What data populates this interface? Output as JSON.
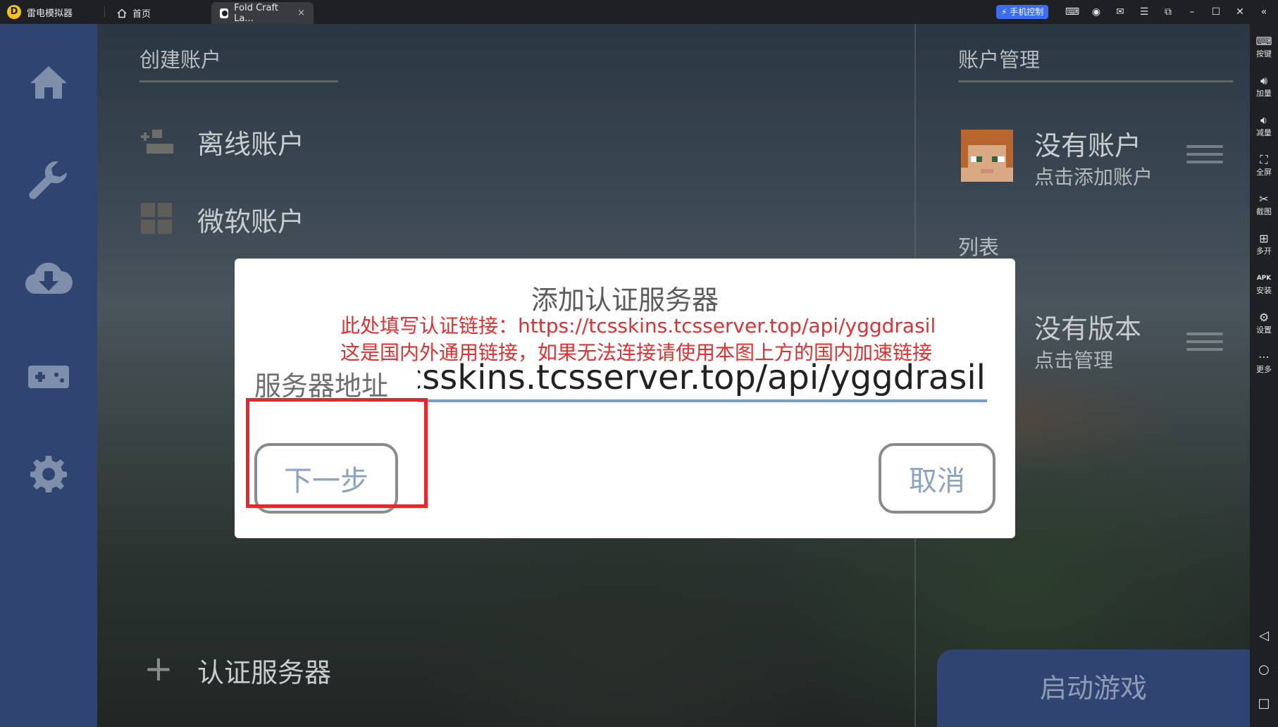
{
  "titlebar": {
    "app_name": "雷电模拟器",
    "tabs": [
      {
        "label": "首页"
      },
      {
        "label": "Fold Craft La..."
      }
    ],
    "close_glyph": "×",
    "phone_control": "手机控制",
    "icons": [
      "gamepad-icon",
      "user-icon",
      "mail-icon",
      "menu-icon",
      "restore-icon",
      "minimize-icon",
      "maximize-icon",
      "close-icon",
      "collapse-icon"
    ]
  },
  "rightbar": {
    "items": [
      {
        "label": "按键",
        "icon": "keyboard-icon"
      },
      {
        "label": "加量",
        "icon": "volume-up-icon"
      },
      {
        "label": "减量",
        "icon": "volume-down-icon"
      },
      {
        "label": "全屏",
        "icon": "fullscreen-icon"
      },
      {
        "label": "截图",
        "icon": "scissors-icon"
      },
      {
        "label": "多开",
        "icon": "multi-instance-icon"
      },
      {
        "label": "安装",
        "icon": "apk-icon"
      },
      {
        "label": "设置",
        "icon": "settings-icon"
      },
      {
        "label": "更多",
        "icon": "more-icon"
      }
    ],
    "nav": [
      "back-icon",
      "home-circle-icon",
      "recents-icon"
    ]
  },
  "left_panel": {
    "title": "创建账户",
    "items": [
      {
        "label": "离线账户",
        "icon": "offline-user-icon"
      },
      {
        "label": "微软账户",
        "icon": "microsoft-icon"
      }
    ],
    "auth_server": {
      "label": "认证服务器",
      "icon": "plus-icon",
      "glyph": "+"
    }
  },
  "right_panel": {
    "title": "账户管理",
    "account": {
      "title": "没有账户",
      "subtitle": "点击添加账户"
    },
    "list_title_partial": "列表",
    "version": {
      "title": "没有版本",
      "subtitle": "点击管理"
    }
  },
  "launch": {
    "label": "启动游戏"
  },
  "dialog": {
    "title": "添加认证服务器",
    "note_line1": "此处填写认证链接：https://tcsskins.tcsserver.top/api/yggdrasil",
    "note_line2": "这是国内外通用链接，如果无法连接请使用本图上方的国内加速链接",
    "field_label": "服务器地址",
    "field_value": "https://tcsskins.tcsserver.top/api/yggdrasil",
    "next_button": "下一步",
    "cancel_button": "取消"
  },
  "colors": {
    "sidebar": "#2f4470",
    "highlight_box": "#e8272b",
    "note_text": "#e23030",
    "input_underline": "#7b9ed0"
  }
}
